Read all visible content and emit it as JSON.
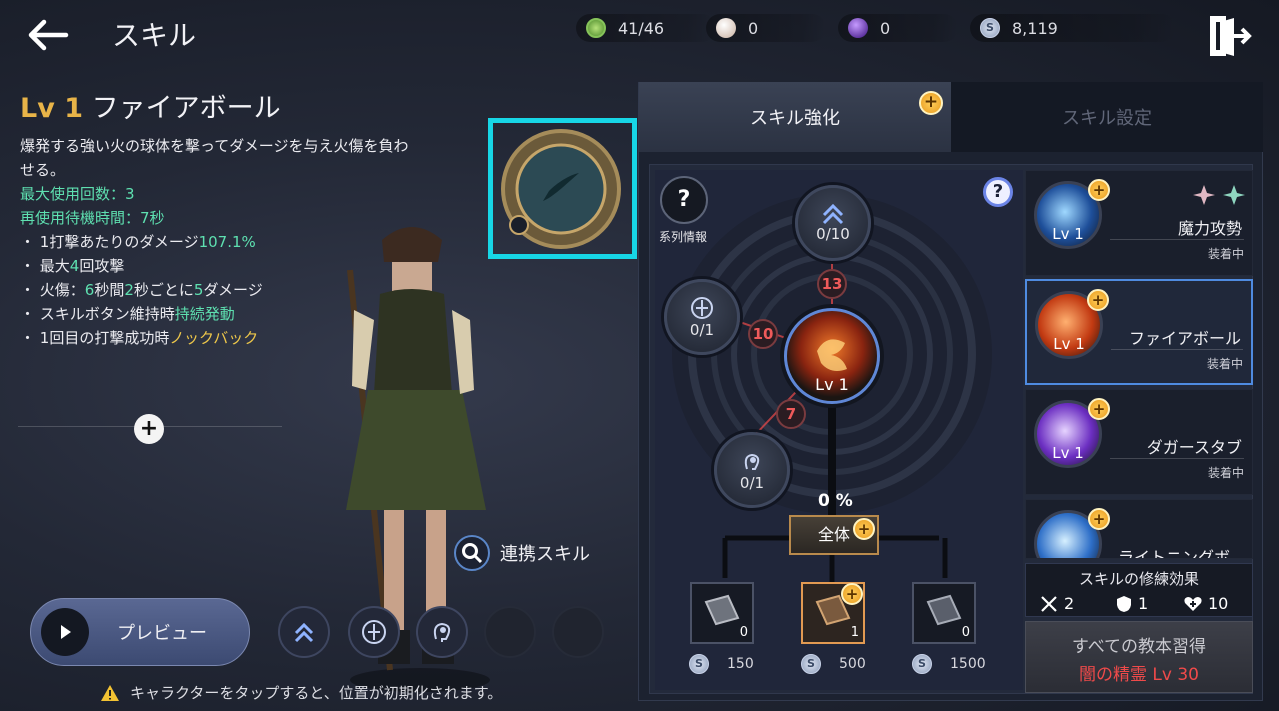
{
  "header": {
    "title": "スキル"
  },
  "currencies": [
    {
      "name": "green-orb",
      "value": "41/46",
      "color": "#6fbf4a"
    },
    {
      "name": "pearl",
      "value": "0",
      "color": "#f0e0d0"
    },
    {
      "name": "purple-orb",
      "value": "0",
      "color": "#6a2fd0"
    },
    {
      "name": "silver-coin",
      "value": "8,119",
      "color": "#a9b8d8"
    }
  ],
  "skill_detail": {
    "lv_prefix": "Lv 1",
    "name": "ファイアボール",
    "description": "爆発する強い火の球体を撃ってダメージを与え火傷を負わせる。",
    "max_uses_label": "最大使用回数：3",
    "cooldown_label": "再使用待機時間：7秒",
    "bullet1": {
      "text": "1打撃あたりのダメージ",
      "value": "107.1%"
    },
    "bullet2": {
      "pre": "最大",
      "num": "4",
      "post": "回攻撃"
    },
    "bullet3": {
      "pre": "火傷：",
      "a": "6",
      "mid1": "秒間",
      "b": "2",
      "mid2": "秒ごとに",
      "c": "5",
      "post": "ダメージ"
    },
    "bullet4": {
      "pre": "スキルボタン維持時",
      "hl": "持続発動"
    },
    "bullet5": {
      "pre": "1回目の打撃成功時",
      "hl": "ノックバック"
    }
  },
  "link_skill_label": "連携スキル",
  "preview_label": "プレビュー",
  "notice": "キャラクターをタップすると、位置が初期化されます。",
  "tabs": {
    "enhance": "スキル強化",
    "settings": "スキル設定"
  },
  "tree": {
    "series_info_label": "系列情報",
    "nodes": [
      {
        "id": "top",
        "value": "0/10",
        "icon": "chevron-up-icon"
      },
      {
        "id": "left",
        "value": "0/1",
        "icon": "rune-icon"
      },
      {
        "id": "bottom-left",
        "value": "0/1",
        "icon": "head-icon"
      }
    ],
    "points": {
      "top": "13",
      "left": "10",
      "bottom": "7"
    },
    "center_lv": "Lv 1",
    "progress": "0 %",
    "all_button": "全体",
    "books": [
      {
        "count": "0",
        "cost": "150"
      },
      {
        "count": "1",
        "cost": "500"
      },
      {
        "count": "0",
        "cost": "1500"
      }
    ]
  },
  "skill_list": [
    {
      "name": "魔力攻勢",
      "lv": "Lv 1",
      "status": "装着中",
      "color": "#3c8ee8"
    },
    {
      "name": "ファイアボール",
      "lv": "Lv 1",
      "status": "装着中",
      "color": "#e8592a"
    },
    {
      "name": "ダガースタブ",
      "lv": "Lv 1",
      "status": "装着中",
      "color": "#8d4ee8"
    },
    {
      "name": "ライトニングボ",
      "lv": "",
      "status": "",
      "color": "#4aa0f0"
    }
  ],
  "mastery": {
    "title": "スキルの修練効果",
    "attack": "2",
    "defense": "1",
    "health": "10"
  },
  "learn_all": {
    "title": "すべての教本習得",
    "requirement": "闇の精霊 Lv 30"
  }
}
